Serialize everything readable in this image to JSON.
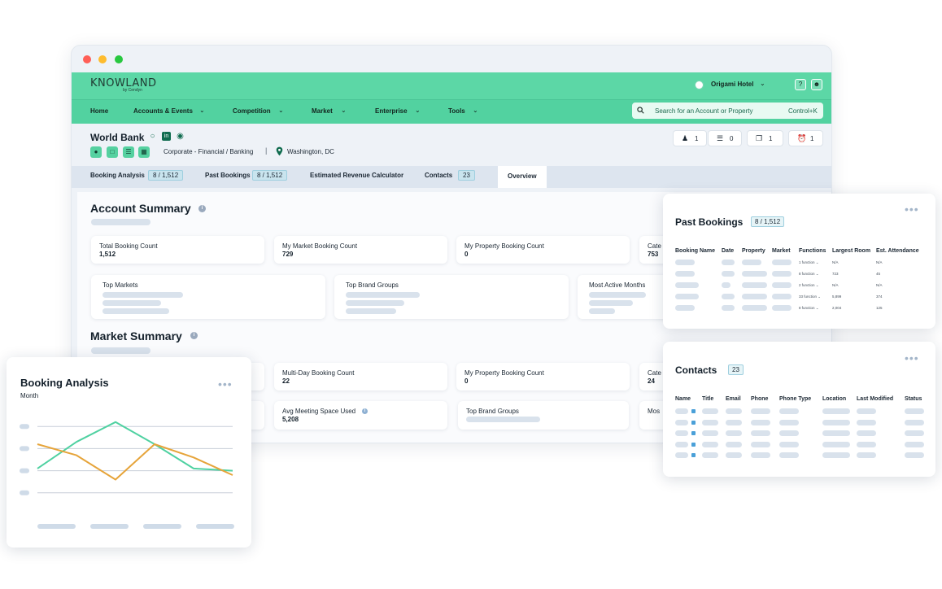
{
  "app": {
    "logo": "KNOWLAND",
    "logo_sub": "by Cendyn",
    "hotel": "Origami Hotel"
  },
  "nav": {
    "items": [
      "Home",
      "Accounts & Events",
      "Competition",
      "Market",
      "Enterprise",
      "Tools"
    ],
    "search_placeholder": "Search for an Account or Property",
    "search_shortcut": "Control+K"
  },
  "account": {
    "name": "World Bank",
    "category": "Corporate  - Financial / Banking",
    "separator": "|",
    "location": "Washington, DC",
    "stats": [
      {
        "icon": "user-icon",
        "value": "1"
      },
      {
        "icon": "layers-icon",
        "value": "0"
      },
      {
        "icon": "copy-icon",
        "value": "1"
      },
      {
        "icon": "alarm-icon",
        "value": "1"
      }
    ]
  },
  "tabs": [
    {
      "label": "Booking Analysis",
      "badge": "8 / 1,512"
    },
    {
      "label": "Past Bookings",
      "badge": "8 / 1,512"
    },
    {
      "label": "Estimated Revenue Calculator",
      "badge": ""
    },
    {
      "label": "Contacts",
      "badge": "23"
    },
    {
      "label": "Overview",
      "badge": ""
    }
  ],
  "account_summary": {
    "title": "Account Summary",
    "cards": [
      {
        "label": "Total Booking Count",
        "value": "1,512"
      },
      {
        "label": "My Market Booking Count",
        "value": "729"
      },
      {
        "label": "My Property Booking Count",
        "value": "0"
      },
      {
        "label": "Cate",
        "value": "753"
      }
    ],
    "lists": [
      "Top Markets",
      "Top Brand Groups",
      "Most Active Months"
    ]
  },
  "market_summary": {
    "title": "Market Summary",
    "cards": [
      {
        "label": "Multi-Day Booking Count",
        "value": "22"
      },
      {
        "label": "My Property Booking Count",
        "value": "0"
      },
      {
        "label": "Cate",
        "value": "24"
      },
      {
        "label": "Avg Meeting Space Used",
        "value": "5,208"
      },
      {
        "label": "Top Brand Groups",
        "value": ""
      },
      {
        "label": "Mos",
        "value": ""
      }
    ]
  },
  "past_bookings": {
    "title": "Past Bookings",
    "badge": "8 / 1,512",
    "columns": [
      "Booking Name",
      "Date",
      "Property",
      "Market",
      "Functions",
      "Largest Room",
      "Est. Attendance"
    ],
    "rows": [
      {
        "functions": "1 function",
        "largest_room": "N/A",
        "attendance": "N/A"
      },
      {
        "functions": "8 function",
        "largest_room": "723",
        "attendance": "45"
      },
      {
        "functions": "2 function",
        "largest_room": "N/A",
        "attendance": "N/A"
      },
      {
        "functions": "33 function",
        "largest_room": "5,899",
        "attendance": "374"
      },
      {
        "functions": "8 function",
        "largest_room": "2,004",
        "attendance": "125"
      }
    ]
  },
  "contacts": {
    "title": "Contacts",
    "badge": "23",
    "columns": [
      "Name",
      "Title",
      "Email",
      "Phone",
      "Phone Type",
      "Location",
      "Last Modified",
      "Status"
    ]
  },
  "booking_analysis": {
    "title": "Booking Analysis",
    "subtitle": "Month"
  },
  "chart_data": {
    "type": "line",
    "title": "Booking Analysis",
    "xlabel": "Month",
    "ylabel": "",
    "x": [
      1,
      2,
      3,
      4,
      5,
      6
    ],
    "series": [
      {
        "color": "#4fd1a1",
        "values": [
          2.1,
          3.3,
          4.2,
          3.2,
          2.1,
          2.0
        ]
      },
      {
        "color": "#e6a43a",
        "values": [
          3.2,
          2.7,
          1.6,
          3.2,
          2.6,
          1.8
        ]
      }
    ],
    "ylim": [
      0,
      5
    ],
    "grid": true,
    "axis_labels_placeholder": true
  },
  "colors": {
    "brand_green": "#5cd7a6",
    "series_green": "#4fd1a1",
    "series_orange": "#e6a43a",
    "placeholder": "#d9e2ec"
  }
}
